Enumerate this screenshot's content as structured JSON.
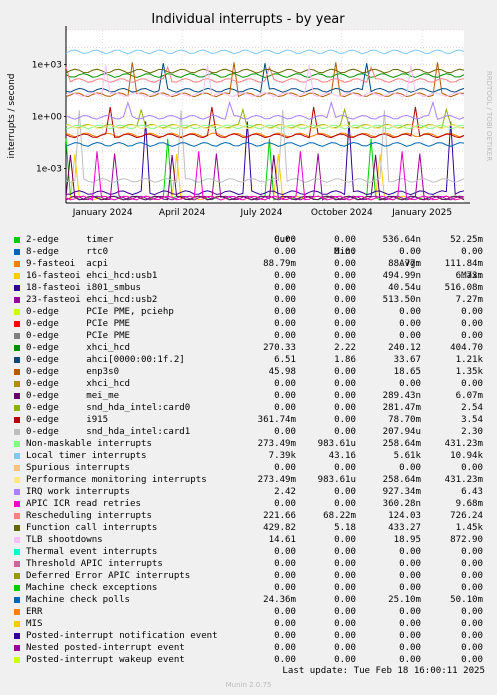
{
  "chart_data": {
    "type": "line",
    "title": "Individual interrupts - by year",
    "ylabel": "interrupts / second",
    "yscale": "log",
    "ylim": [
      1e-05,
      100000
    ],
    "y_ticks": [
      "1e+03",
      "1e+00",
      "1e-03"
    ],
    "x_ticks": [
      "January 2024",
      "April 2024",
      "July 2024",
      "October 2024",
      "January 2025"
    ],
    "xlim": [
      "2023-11-20",
      "2025-02-18"
    ],
    "legend_placement": "bottom",
    "side_label": "RRDTOOL / TOBI OETIKER",
    "columns": [
      "Cur:",
      "Min:",
      "Avg:",
      "Max:"
    ],
    "series": [
      {
        "name": "2-edge",
        "desc": "timer",
        "color": "#00cc00",
        "cur": "0.00",
        "min": "0.00",
        "avg": "536.64n",
        "max": "52.25m"
      },
      {
        "name": "8-edge",
        "desc": "rtc0",
        "color": "#0066b3",
        "cur": "0.00",
        "min": "0.00",
        "avg": "0.00",
        "max": "0.00"
      },
      {
        "name": "9-fasteoi",
        "desc": "acpi",
        "color": "#ff8000",
        "cur": "88.79m",
        "min": "0.00",
        "avg": "88.77m",
        "max": "111.84m"
      },
      {
        "name": "16-fasteoi",
        "desc": "ehci_hcd:usb1",
        "color": "#ffcc00",
        "cur": "0.00",
        "min": "0.00",
        "avg": "494.99n",
        "max": "6.73m"
      },
      {
        "name": "18-fasteoi",
        "desc": "i801_smbus",
        "color": "#330099",
        "cur": "0.00",
        "min": "0.00",
        "avg": "40.54u",
        "max": "516.08m"
      },
      {
        "name": "23-fasteoi",
        "desc": "ehci_hcd:usb2",
        "color": "#990099",
        "cur": "0.00",
        "min": "0.00",
        "avg": "513.50n",
        "max": "7.27m"
      },
      {
        "name": "0-edge",
        "desc": "PCIe PME, pciehp",
        "color": "#ccff00",
        "cur": "0.00",
        "min": "0.00",
        "avg": "0.00",
        "max": "0.00"
      },
      {
        "name": "0-edge",
        "desc": "PCIe PME",
        "color": "#ff0000",
        "cur": "0.00",
        "min": "0.00",
        "avg": "0.00",
        "max": "0.00"
      },
      {
        "name": "0-edge",
        "desc": "PCIe PME",
        "color": "#808080",
        "cur": "0.00",
        "min": "0.00",
        "avg": "0.00",
        "max": "0.00"
      },
      {
        "name": "0-edge",
        "desc": "xhci_hcd",
        "color": "#008f00",
        "cur": "270.33",
        "min": "2.22",
        "avg": "240.12",
        "max": "404.70"
      },
      {
        "name": "0-edge",
        "desc": "ahci[0000:00:1f.2]",
        "color": "#00487d",
        "cur": "6.51",
        "min": "1.86",
        "avg": "33.67",
        "max": "1.21k"
      },
      {
        "name": "0-edge",
        "desc": "enp3s0",
        "color": "#b35a00",
        "cur": "45.98",
        "min": "0.00",
        "avg": "18.65",
        "max": "1.35k"
      },
      {
        "name": "0-edge",
        "desc": "xhci_hcd",
        "color": "#b38f00",
        "cur": "0.00",
        "min": "0.00",
        "avg": "0.00",
        "max": "0.00"
      },
      {
        "name": "0-edge",
        "desc": "mei_me",
        "color": "#6b006b",
        "cur": "0.00",
        "min": "0.00",
        "avg": "289.43n",
        "max": "6.07m"
      },
      {
        "name": "0-edge",
        "desc": "snd_hda_intel:card0",
        "color": "#8fb300",
        "cur": "0.00",
        "min": "0.00",
        "avg": "281.47m",
        "max": "2.54"
      },
      {
        "name": "0-edge",
        "desc": "i915",
        "color": "#b30000",
        "cur": "361.74m",
        "min": "0.00",
        "avg": "78.70m",
        "max": "3.54"
      },
      {
        "name": "0-edge",
        "desc": "snd_hda_intel:card1",
        "color": "#bebebe",
        "cur": "0.00",
        "min": "0.00",
        "avg": "207.94u",
        "max": "2.30"
      },
      {
        "name": "Non-maskable interrupts",
        "desc": "",
        "color": "#80ff80",
        "cur": "273.49m",
        "min": "983.61u",
        "avg": "258.64m",
        "max": "431.23m"
      },
      {
        "name": "Local timer interrupts",
        "desc": "",
        "color": "#80c9ff",
        "cur": "7.39k",
        "min": "43.16",
        "avg": "5.61k",
        "max": "10.94k"
      },
      {
        "name": "Spurious interrupts",
        "desc": "",
        "color": "#ffc080",
        "cur": "0.00",
        "min": "0.00",
        "avg": "0.00",
        "max": "0.00"
      },
      {
        "name": "Performance monitoring interrupts",
        "desc": "",
        "color": "#ffe680",
        "cur": "273.49m",
        "min": "983.61u",
        "avg": "258.64m",
        "max": "431.23m"
      },
      {
        "name": "IRQ work interrupts",
        "desc": "",
        "color": "#aa80ff",
        "cur": "2.42",
        "min": "0.00",
        "avg": "927.34m",
        "max": "6.43"
      },
      {
        "name": "APIC ICR read retries",
        "desc": "",
        "color": "#ee00cc",
        "cur": "0.00",
        "min": "0.00",
        "avg": "360.28n",
        "max": "9.68m"
      },
      {
        "name": "Rescheduling interrupts",
        "desc": "",
        "color": "#ff8080",
        "cur": "221.66",
        "min": "68.22m",
        "avg": "124.03",
        "max": "726.24"
      },
      {
        "name": "Function call interrupts",
        "desc": "",
        "color": "#666600",
        "cur": "429.82",
        "min": "5.18",
        "avg": "433.27",
        "max": "1.45k"
      },
      {
        "name": "TLB shootdowns",
        "desc": "",
        "color": "#ffbfff",
        "cur": "14.61",
        "min": "0.00",
        "avg": "18.95",
        "max": "872.90"
      },
      {
        "name": "Thermal event interrupts",
        "desc": "",
        "color": "#00ffcc",
        "cur": "0.00",
        "min": "0.00",
        "avg": "0.00",
        "max": "0.00"
      },
      {
        "name": "Threshold APIC interrupts",
        "desc": "",
        "color": "#cc6699",
        "cur": "0.00",
        "min": "0.00",
        "avg": "0.00",
        "max": "0.00"
      },
      {
        "name": "Deferred Error APIC interrupts",
        "desc": "",
        "color": "#999900",
        "cur": "0.00",
        "min": "0.00",
        "avg": "0.00",
        "max": "0.00"
      },
      {
        "name": "Machine check exceptions",
        "desc": "",
        "color": "#00cc00",
        "cur": "0.00",
        "min": "0.00",
        "avg": "0.00",
        "max": "0.00"
      },
      {
        "name": "Machine check polls",
        "desc": "",
        "color": "#0066b3",
        "cur": "24.36m",
        "min": "0.00",
        "avg": "25.10m",
        "max": "50.10m"
      },
      {
        "name": "ERR",
        "desc": "",
        "color": "#ff8000",
        "cur": "0.00",
        "min": "0.00",
        "avg": "0.00",
        "max": "0.00"
      },
      {
        "name": "MIS",
        "desc": "",
        "color": "#ffcc00",
        "cur": "0.00",
        "min": "0.00",
        "avg": "0.00",
        "max": "0.00"
      },
      {
        "name": "Posted-interrupt notification event",
        "desc": "",
        "color": "#330099",
        "cur": "0.00",
        "min": "0.00",
        "avg": "0.00",
        "max": "0.00"
      },
      {
        "name": "Nested posted-interrupt event",
        "desc": "",
        "color": "#990099",
        "cur": "0.00",
        "min": "0.00",
        "avg": "0.00",
        "max": "0.00"
      },
      {
        "name": "Posted-interrupt wakeup event",
        "desc": "",
        "color": "#ccff00",
        "cur": "0.00",
        "min": "0.00",
        "avg": "0.00",
        "max": "0.00"
      }
    ]
  },
  "footer": {
    "last_update": "Last update:  Tue Feb 18 16:00:11 2025",
    "version": "Munin 2.0.75"
  }
}
